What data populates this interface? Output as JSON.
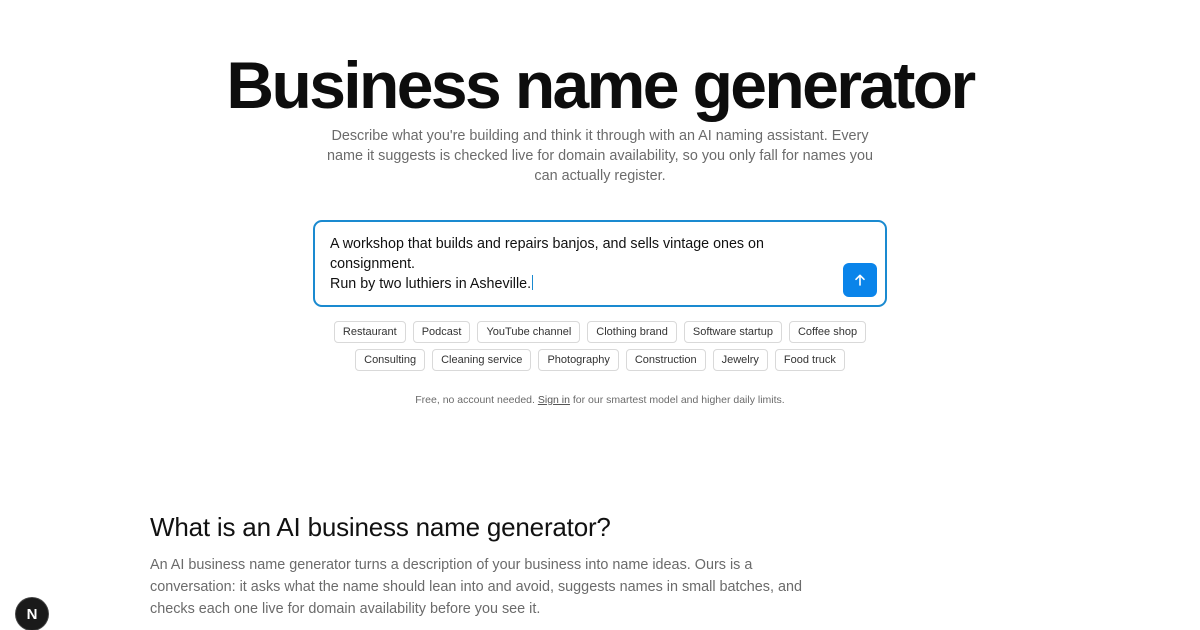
{
  "hero": {
    "title": "Business name generator",
    "subtitle": "Describe what you're building and think it through with an AI naming assistant. Every name it suggests is checked live for domain availability, so you only fall for names you can actually register."
  },
  "prompt": {
    "line1": "A workshop that builds and repairs banjos, and sells vintage ones on consignment.",
    "line2": "Run by two luthiers in Asheville.",
    "send_icon": "arrow-up-icon",
    "accent_color": "#0a84ea",
    "border_color": "#1a8ad0"
  },
  "chips": {
    "row1": [
      "Restaurant",
      "Podcast",
      "YouTube channel",
      "Clothing brand",
      "Software startup",
      "Coffee shop"
    ],
    "row2": [
      "Consulting",
      "Cleaning service",
      "Photography",
      "Construction",
      "Jewelry",
      "Food truck"
    ]
  },
  "footnote": {
    "before": "Free, no account needed. ",
    "link": "Sign in",
    "after": " for our smartest model and higher daily limits."
  },
  "section": {
    "title": "What is an AI business name generator?",
    "body": "An AI business name generator turns a description of your business into name ideas. Ours is a conversation: it asks what the name should lean into and avoid, suggests names in small batches, and checks each one live for domain availability before you see it."
  },
  "badge": {
    "letter": "N"
  }
}
